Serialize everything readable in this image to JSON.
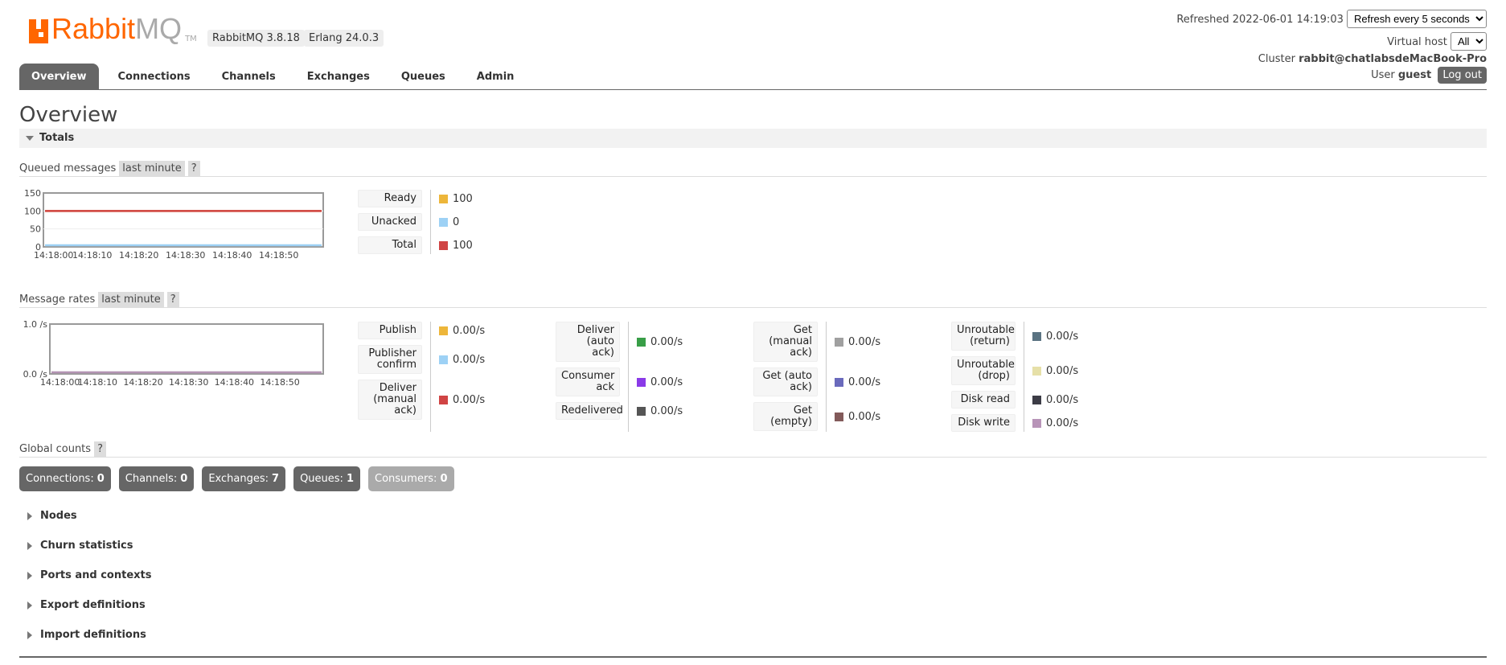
{
  "header": {
    "logo_text": "RabbitMQ",
    "logo_tm": "TM",
    "version": "RabbitMQ 3.8.18",
    "erlang": "Erlang 24.0.3",
    "refreshed_label": "Refreshed 2022-06-01 14:19:03",
    "refresh_select": "Refresh every 5 seconds",
    "vhost_label": "Virtual host",
    "vhost_select": "All",
    "cluster_label": "Cluster",
    "cluster_name": "rabbit@chatlabsdeMacBook-Pro",
    "user_label": "User",
    "user_name": "guest",
    "logout": "Log out"
  },
  "tabs": [
    {
      "label": "Overview",
      "active": true
    },
    {
      "label": "Connections"
    },
    {
      "label": "Channels"
    },
    {
      "label": "Exchanges"
    },
    {
      "label": "Queues"
    },
    {
      "label": "Admin"
    }
  ],
  "page_title": "Overview",
  "totals_label": "Totals",
  "queued": {
    "title": "Queued messages",
    "range": "last minute",
    "help": "?",
    "chart_data": {
      "type": "line",
      "x": [
        "14:18:00",
        "14:18:10",
        "14:18:20",
        "14:18:30",
        "14:18:40",
        "14:18:50"
      ],
      "ylim": [
        0,
        150
      ],
      "yticks": [
        "150",
        "100",
        "50",
        "0"
      ],
      "series": [
        {
          "name": "Ready",
          "color": "#edb63a",
          "values": [
            100,
            100,
            100,
            100,
            100,
            100
          ]
        },
        {
          "name": "Unacked",
          "color": "#9dd1f5",
          "values": [
            0,
            0,
            0,
            0,
            0,
            0
          ]
        },
        {
          "name": "Total",
          "color": "#d04444",
          "values": [
            100,
            100,
            100,
            100,
            100,
            100
          ]
        }
      ]
    },
    "legend": [
      {
        "label": "Ready",
        "value": "100",
        "color": "#edb63a"
      },
      {
        "label": "Unacked",
        "value": "0",
        "color": "#9dd1f5"
      },
      {
        "label": "Total",
        "value": "100",
        "color": "#d04444"
      }
    ]
  },
  "rates": {
    "title": "Message rates",
    "range": "last minute",
    "help": "?",
    "chart_data": {
      "type": "line",
      "x": [
        "14:18:00",
        "14:18:10",
        "14:18:20",
        "14:18:30",
        "14:18:40",
        "14:18:50"
      ],
      "ylim": [
        0,
        1.0
      ],
      "yticks": [
        "1.0 /s",
        "0.0 /s"
      ],
      "series": [
        {
          "values": [
            0,
            0,
            0,
            0,
            0,
            0
          ],
          "color": "#b494b4"
        }
      ]
    },
    "columns": [
      [
        {
          "label": "Publish",
          "value": "0.00/s",
          "color": "#edb63a"
        },
        {
          "label": "Publisher confirm",
          "value": "0.00/s",
          "color": "#9dd1f5"
        },
        {
          "label": "Deliver (manual ack)",
          "value": "0.00/s",
          "color": "#d04444"
        }
      ],
      [
        {
          "label": "Deliver (auto ack)",
          "value": "0.00/s",
          "color": "#389e47"
        },
        {
          "label": "Consumer ack",
          "value": "0.00/s",
          "color": "#8a3ae8"
        },
        {
          "label": "Redelivered",
          "value": "0.00/s",
          "color": "#555555"
        }
      ],
      [
        {
          "label": "Get (manual ack)",
          "value": "0.00/s",
          "color": "#a0a0a0"
        },
        {
          "label": "Get (auto ack)",
          "value": "0.00/s",
          "color": "#6a6abc"
        },
        {
          "label": "Get (empty)",
          "value": "0.00/s",
          "color": "#825a5a"
        }
      ],
      [
        {
          "label": "Unroutable (return)",
          "value": "0.00/s",
          "color": "#5a7382"
        },
        {
          "label": "Unroutable (drop)",
          "value": "0.00/s",
          "color": "#e6e0a8"
        },
        {
          "label": "Disk read",
          "value": "0.00/s",
          "color": "#3c3c46"
        },
        {
          "label": "Disk write",
          "value": "0.00/s",
          "color": "#b894b8"
        }
      ]
    ]
  },
  "global": {
    "title": "Global counts",
    "help": "?",
    "counts": [
      {
        "label": "Connections:",
        "value": "0"
      },
      {
        "label": "Channels:",
        "value": "0"
      },
      {
        "label": "Exchanges:",
        "value": "7"
      },
      {
        "label": "Queues:",
        "value": "1"
      },
      {
        "label": "Consumers:",
        "value": "0"
      }
    ]
  },
  "sections": [
    "Nodes",
    "Churn statistics",
    "Ports and contexts",
    "Export definitions",
    "Import definitions"
  ]
}
